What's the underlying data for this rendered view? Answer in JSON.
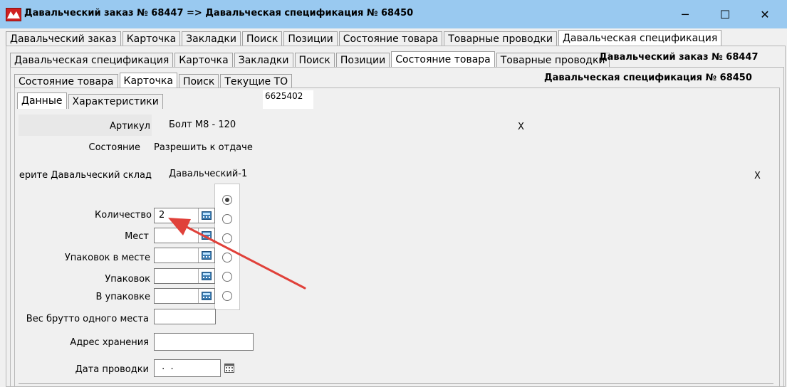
{
  "window": {
    "title": "Давальческий заказ № 68447 => Давальческая спецификация № 68450",
    "minimize": "─",
    "maximize": "☐",
    "close": "✕"
  },
  "tabs_level1": [
    "Давальческий заказ",
    "Карточка",
    "Закладки",
    "Поиск",
    "Позиции",
    "Состояние товара",
    "Товарные проводки",
    "Давальческая спецификация"
  ],
  "tabs_level2": [
    "Давальческая спецификация",
    "Карточка",
    "Закладки",
    "Поиск",
    "Позиции",
    "Состояние товара",
    "Товарные проводки"
  ],
  "order_caption": "Давальческий заказ № 68447",
  "tabs_level3": [
    "Состояние товара",
    "Карточка",
    "Поиск",
    "Текущие ТО"
  ],
  "spec_caption": "Давальческая спецификация № 68450",
  "tabs_level4": [
    "Данные",
    "Характеристики"
  ],
  "code_value": "6625402",
  "form": {
    "article_label": "Артикул",
    "article_value": "Болт М8  - 120",
    "article_clear": "X",
    "state_label": "Состояние",
    "state_value": "Разрешить к отдаче",
    "warehouse_label": "ерите Давальческий склад",
    "warehouse_value": "Давальческий-1",
    "warehouse_clear": "X",
    "quantity_label": "Количество",
    "quantity_value": "2",
    "places_label": "Мест",
    "places_value": "",
    "packs_in_place_label": "Упаковок в месте",
    "packs_in_place_value": "",
    "packs_label": "Упаковок",
    "packs_value": "",
    "in_pack_label": "В упаковке",
    "in_pack_value": "",
    "gross_weight_label": "Вес брутто одного места",
    "gross_weight_value": "",
    "storage_address_label": "Адрес хранения",
    "storage_address_value": "",
    "posting_date_label": "Дата проводки",
    "posting_date_value": " .  ."
  },
  "colors": {
    "titlebar": "#99c9f0",
    "arrow": "#e0413a",
    "logo": "#d02020"
  },
  "icons": {
    "calculator": "calculator-icon",
    "calendar": "calendar-icon"
  }
}
